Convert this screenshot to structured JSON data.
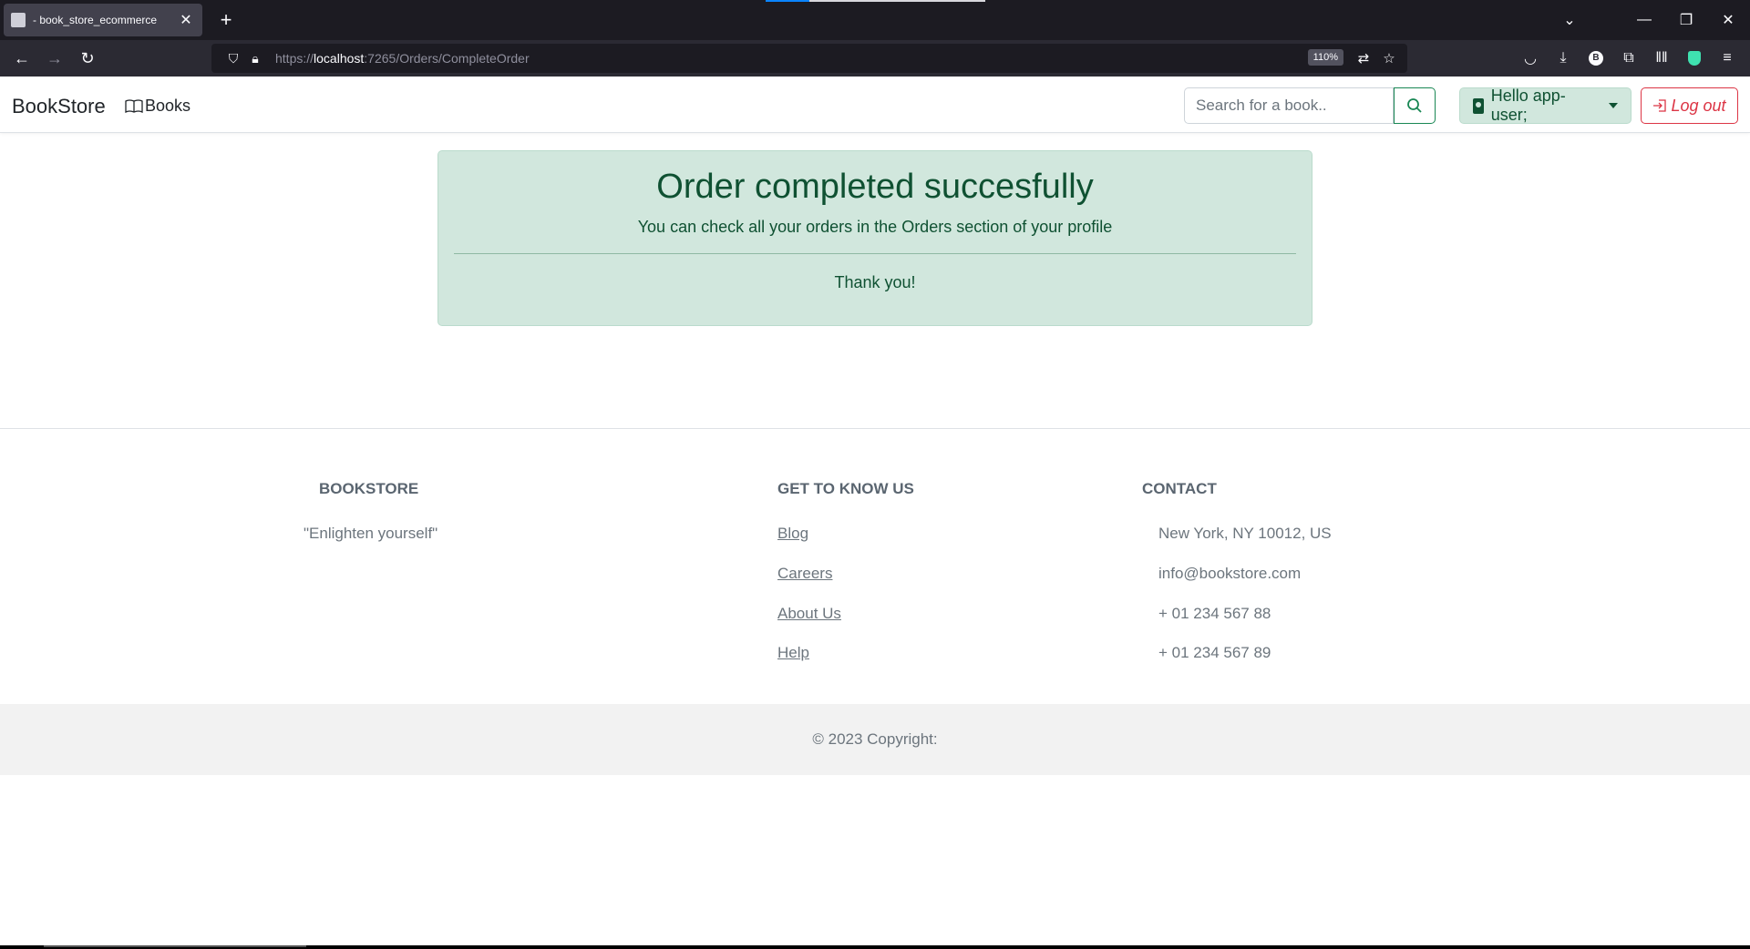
{
  "browser": {
    "tab_title": "- book_store_ecommerce",
    "url_scheme": "https://",
    "url_host": "localhost",
    "url_rest": ":7265/Orders/CompleteOrder",
    "zoom": "110%"
  },
  "nav": {
    "brand": "BookStore",
    "books_link": "Books",
    "search_placeholder": "Search for a book..",
    "user_label": "Hello app-user;",
    "logout_label": "Log out"
  },
  "alert": {
    "title": "Order completed succesfully",
    "subtitle": "You can check all your orders in the Orders section of your profile",
    "thanks": "Thank you!"
  },
  "footer": {
    "bookstore_heading": "BOOKSTORE",
    "tagline": "\"Enlighten yourself\"",
    "know_heading": "GET TO KNOW US",
    "links": [
      "Blog",
      "Careers",
      "About Us",
      "Help"
    ],
    "contact_heading": "CONTACT",
    "contact": [
      "New York, NY 10012, US",
      "info@bookstore.com",
      "+ 01 234 567 88",
      "+ 01 234 567 89"
    ],
    "copyright": "© 2023 Copyright:"
  },
  "colors": {
    "success_bg": "#d1e7dd",
    "success_text": "#0f5132",
    "danger": "#dc3545",
    "success_border": "#198754"
  }
}
